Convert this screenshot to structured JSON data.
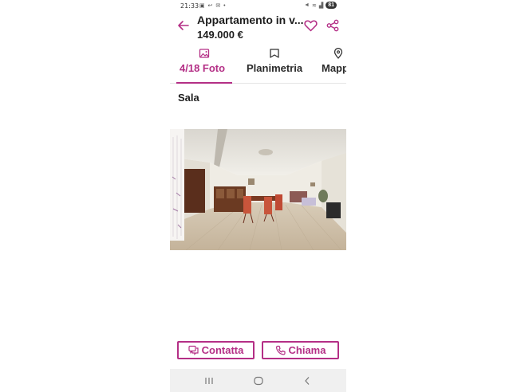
{
  "status_bar": {
    "time": "21:33",
    "notification_icons": "▣ ↩ ✉ •",
    "battery": "81"
  },
  "header": {
    "title": "Appartamento in v...",
    "price": "149.000 €"
  },
  "tabs": [
    {
      "label": "4/18 Foto",
      "active": true
    },
    {
      "label": "Planimetria",
      "active": false
    },
    {
      "label": "Mappa",
      "active": false
    }
  ],
  "photo": {
    "caption": "Sala",
    "depicts": "living-room-interior"
  },
  "actions": {
    "contact_label": "Contatta",
    "call_label": "Chiama"
  },
  "colors": {
    "accent": "#b42f86",
    "text": "#1d1d1d",
    "nav_background": "#f0f0f0"
  }
}
